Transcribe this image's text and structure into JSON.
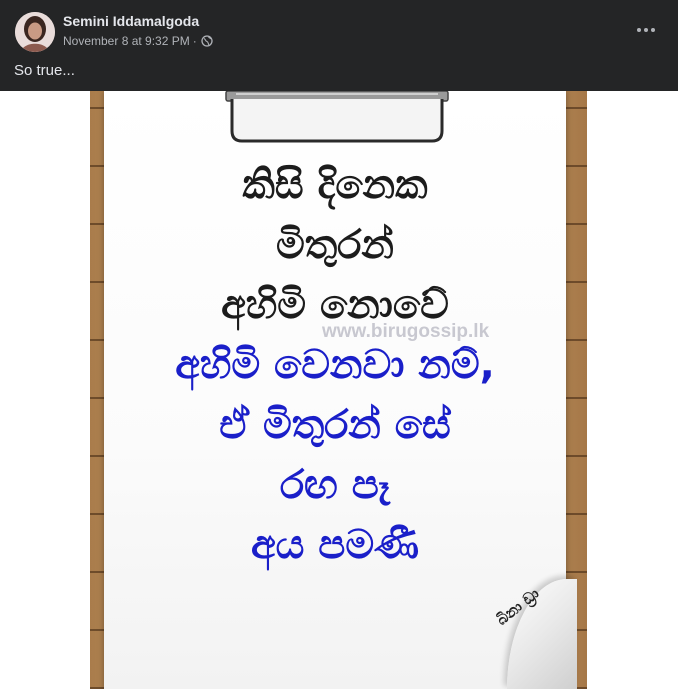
{
  "post": {
    "author": "Semini Iddamalgoda",
    "timestamp": "November 8 at 9:32 PM",
    "separator": "·",
    "privacy_icon": "globe-icon",
    "more_icon": "more-options-icon",
    "caption": "So true...",
    "colors": {
      "header_bg": "#242526",
      "text_primary": "#e4e6eb",
      "text_secondary": "#b0b3b8",
      "quote_black": "#1c1c1c",
      "quote_blue": "#1a1fc9"
    }
  },
  "image": {
    "quote_lines": [
      "කිසි දිනෙක",
      "මිතුරන්",
      "අහිමි නොවේ",
      "අහිමි වෙනවා නම්,",
      "ඒ මිතුරන් සේ",
      "රඟ පෑ",
      "අය පමණී"
    ],
    "watermark": "www.birugossip.lk",
    "stamp_text": "බිනා ඩ්‍රා"
  }
}
